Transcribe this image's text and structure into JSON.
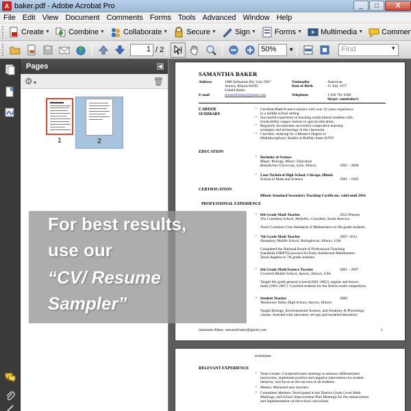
{
  "window": {
    "title": "baker.pdf - Adobe Acrobat Pro",
    "min": "_",
    "max": "□",
    "close": "X"
  },
  "menu": [
    "File",
    "Edit",
    "View",
    "Document",
    "Comments",
    "Forms",
    "Tools",
    "Advanced",
    "Window",
    "Help"
  ],
  "tasks": [
    "Create",
    "Combine",
    "Collaborate",
    "Secure",
    "Sign",
    "Forms",
    "Multimedia",
    "Comment"
  ],
  "nav": {
    "current_page": "1",
    "page_total": "/ 2",
    "zoom": "50%",
    "find_placeholder": "Find"
  },
  "pages_panel": {
    "title": "Pages",
    "thumb1": "1",
    "thumb2": "2"
  },
  "colors": {
    "accent": "#d04a2a",
    "selection": "#a7c2dc"
  },
  "resume": {
    "name": "SAMANTHA BAKER",
    "address_label": "Address",
    "address1": "1980 Selmarten Rd, Unit 2907",
    "address2": "Aurora, Illinois 60505",
    "address3": "United States",
    "email_label": "E-mail",
    "email": "samandybaker@gmail.com",
    "nationality_label": "Nationality",
    "nationality": "American",
    "dob_label": "Date of Birth",
    "dob": "15 July 1977",
    "telephone_label": "Telephone",
    "telephone": "1 630 701 9580",
    "skype": "Skype: samsbaker1",
    "career_h1": "CAREER",
    "career_h2": "SUMMARY",
    "summary": [
      "Certified Math/Science teacher with over 10 years experience",
      "in a middle school setting.",
      "Successful experience in teaching multicultural students with",
      "broad ability ranges: honors to special education.",
      "Regularly incorporates successful cooperative learning",
      "strategies and technology in the classroom.",
      "Currently studying for a Master's Degree in",
      "Multidisciplinary Studies at Buffalo State SUNY"
    ],
    "education_h": "EDUCATION",
    "edu1_title": "Bachelor of Science",
    "edu1_line": "Major: Biology, Minor: Education",
    "edu1_school": "Benedictine University, Lisle, Illinois",
    "edu1_years": "1995 – 2000",
    "edu2_title": "Lane Technical High School, Chicago, Illinois",
    "edu2_line": "School of Math and Science",
    "edu2_years": "1991 – 1995",
    "cert_h": "CERTIFICATION",
    "cert_line": "Illinois Standard Secondary Teaching Certificate, valid until 2016",
    "prof_h": "PROFESSIONAL EXPERIENCE",
    "job1_title": "6th Grade Math Teacher",
    "job1_dates": "2012-Present",
    "job1_school": "The Columbus School, Medellin, Colombia, South America",
    "job1_desc": "Teach Common Core Standards of Mathematics to 6th grade students.",
    "job2_title": "7th Grade Math Teacher",
    "job2_dates": "2007- 2012",
    "job2_school": "Humphrey Middle School, Bolingbrook, Illinois, USA",
    "job2_d1": "Completed the National Board of Professional Teaching",
    "job2_d2": "Standards (NBPTS) process for Early Adolescent Mathematics.",
    "job2_d3": "Teach Algebra to 7th grade students.",
    "job3_title": "6th Grade Math/Science Teacher",
    "job3_dates": "2001 – 2007",
    "job3_school": "Cowherd Middle School, Aurora, Illinois, USA",
    "job3_d1": "Taught 6th grade general science(2001-2002), regular and honors",
    "job3_d2": "math (2001-2007). Coached students for the district math competition.",
    "job4_title": "Student Teacher",
    "job4_dates": "2000",
    "job4_school": "Waubonsie Valley High School, Aurora, Illinois",
    "job4_d1": "Taught Biology, Environmental Science, and Anatomy & Physiology",
    "job4_d2": "classes. Assisted with laboratory set-ups and modeled laboratory",
    "footer": "Samantha Baker, samandybaker@gmail.com",
    "footer_page": "1",
    "p2_top": "techniques.",
    "relevant_h": "RELEVANT EXPERIENCE",
    "rel1": "Team Leader: Conducted team meetings to enhance differentiated",
    "rel1b": "instruction, implement positive and negative intervention for student",
    "rel1c": "behavior, and focus on the success of all students.",
    "rel2": "Mentor, Mentored new teachers.",
    "rel3": "Committee Member, Participated in the District Grade Level Math",
    "rel3b": "Meetings, and School Improvement Plan Meetings for the enhancement",
    "rel3c": "and implementation of the school curriculum."
  },
  "overlay": {
    "line1": "For best results,",
    "line2": "use our",
    "line3": "“CV/ Resume",
    "line4": "Sampler”"
  }
}
